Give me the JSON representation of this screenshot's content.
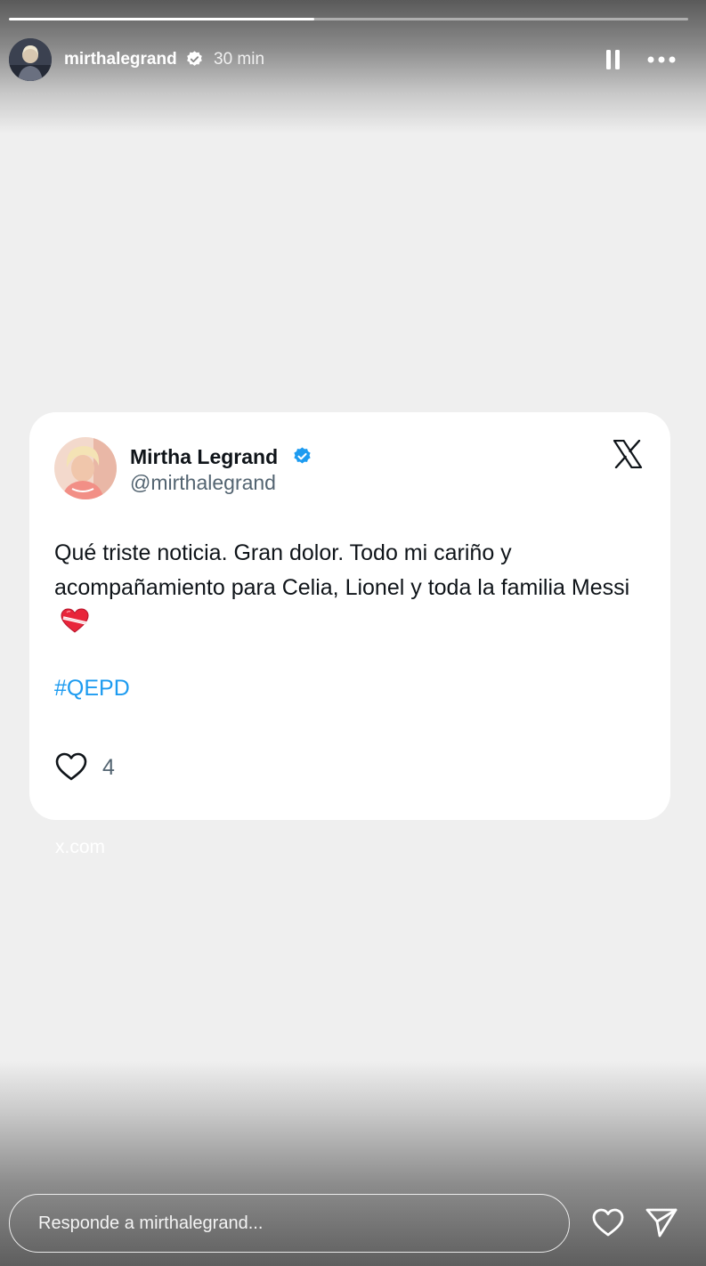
{
  "story": {
    "username": "mirthalegrand",
    "time": "30 min",
    "progress": 0.45,
    "icons": {
      "verified": "verified-badge-icon",
      "pause": "pause-icon",
      "more": "more-options-icon"
    }
  },
  "tweet": {
    "name": "Mirtha Legrand",
    "handle": "@mirthalegrand",
    "text": "Qué triste noticia. Gran dolor. Todo mi cariño y acompañamiento para Celia, Lionel y toda la familia Messi",
    "emoji": "broken-heart-emoji",
    "hashtag": "#QEPD",
    "likes": "4",
    "icons": {
      "verified": "verified-badge-icon",
      "platform_logo": "x-logo-icon",
      "like": "heart-icon"
    },
    "colors": {
      "verified": "#1d9bf0",
      "hashtag": "#1d9bf0",
      "text": "#0f1419",
      "secondary": "#536471"
    }
  },
  "source_domain": "x.com",
  "reply": {
    "placeholder": "Responde a mirthalegrand...",
    "icons": {
      "like": "heart-outline-icon",
      "share": "send-icon"
    }
  }
}
